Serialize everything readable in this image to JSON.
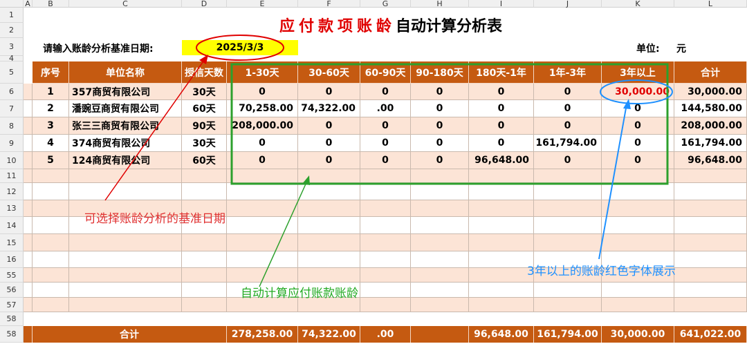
{
  "sheet": {
    "column_headers": [
      "A",
      "B",
      "C",
      "D",
      "E",
      "F",
      "G",
      "H",
      "I",
      "J",
      "K",
      "L"
    ],
    "row_numbers": [
      "1",
      "2",
      "3",
      "4",
      "5",
      "6",
      "7",
      "8",
      "9",
      "10",
      "11",
      "12",
      "13",
      "14",
      "15",
      "16",
      "55",
      "56",
      "57",
      "58"
    ]
  },
  "title": {
    "red_part": "应付款项账龄",
    "black_part": "自动计算分析表"
  },
  "date_row": {
    "label": "请输入账龄分析基准日期:",
    "value": "2025/3/3",
    "unit_label": "单位:",
    "unit_value": "元"
  },
  "table": {
    "headers": [
      "序号",
      "单位名称",
      "授信天数",
      "1-30天",
      "30-60天",
      "60-90天",
      "90-180天",
      "180天-1年",
      "1年-3年",
      "3年以上",
      "合计"
    ],
    "rows": [
      [
        "1",
        "357商贸有限公司",
        "30天",
        "0",
        "0",
        "0",
        "0",
        "0",
        "0",
        "30,000.00",
        "30,000.00"
      ],
      [
        "2",
        "潘豌豆商贸有限公司",
        "60天",
        "70,258.00",
        "74,322.00",
        ".00",
        "0",
        "0",
        "0",
        "0",
        "144,580.00"
      ],
      [
        "3",
        "张三三商贸有限公司",
        "90天",
        "208,000.00",
        "0",
        "0",
        "0",
        "0",
        "0",
        "0",
        "208,000.00"
      ],
      [
        "4",
        "374商贸有限公司",
        "30天",
        "0",
        "0",
        "0",
        "0",
        "0",
        "161,794.00",
        "0",
        "161,794.00"
      ],
      [
        "5",
        "124商贸有限公司",
        "60天",
        "0",
        "0",
        "0",
        "0",
        "96,648.00",
        "0",
        "0",
        "96,648.00"
      ]
    ],
    "total_row": [
      "合计",
      "278,258.00",
      "74,322.00",
      ".00",
      "",
      "96,648.00",
      "161,794.00",
      "30,000.00",
      "641,022.00"
    ]
  },
  "annotations": {
    "date_note": "可选择账龄分析的基准日期",
    "auto_calc_note": "自动计算应付账款账龄",
    "red_font_note": "3年以上的账龄红色字体展示"
  },
  "colors": {
    "header_bg": "#c55a11",
    "band_bg": "#fce4d6",
    "title_red": "#e00000",
    "date_highlight": "#ffff00",
    "red_value": "#e00000",
    "green_box": "#2ca02c",
    "blue_note": "#1e90ff"
  }
}
